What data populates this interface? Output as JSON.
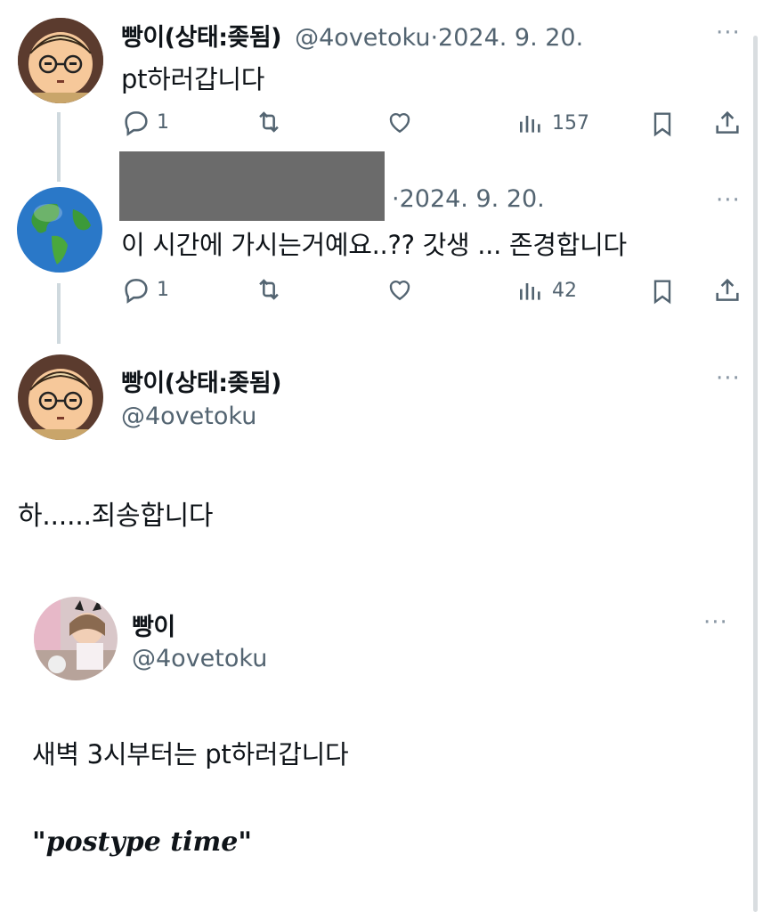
{
  "tweet1": {
    "display_name": "빵이(상태:좆됨)",
    "handle": "@4ovetoku",
    "date_sep": "·",
    "date": "2024. 9. 20.",
    "text": "pt하러갑니다",
    "replies": "1",
    "views": "157"
  },
  "tweet2": {
    "date_sep": "·",
    "date": "2024. 9. 20.",
    "text": "이 시간에 가시는거예요..?? 갓생 ... 존경합니다",
    "replies": "1",
    "views": "42"
  },
  "tweet3": {
    "display_name": "빵이(상태:좆됨)",
    "handle": "@4ovetoku",
    "text": "하......죄송합니다"
  },
  "quoted": {
    "display_name": "빵이",
    "handle": "@4ovetoku",
    "text": "새벽 3시부터는 pt하러갑니다",
    "quote_text": "\"postype time\""
  },
  "more_glyph": "···",
  "colors": {
    "text": "#0f1419",
    "muted": "#536471",
    "thread": "#cfd9de",
    "redact": "#6b6b6b"
  }
}
